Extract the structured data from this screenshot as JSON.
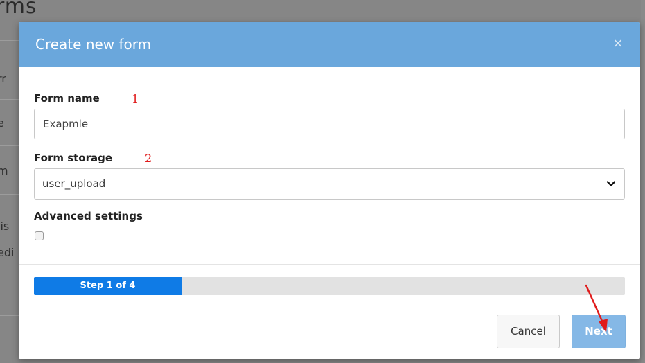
{
  "background": {
    "page_title_fragment": "rms",
    "row_fragments": [
      "rr",
      "e",
      "m",
      "lis",
      "edi"
    ]
  },
  "modal": {
    "title": "Create new form",
    "close_glyph": "×",
    "form_name": {
      "label": "Form name",
      "annotation": "1",
      "value": "Exapmle"
    },
    "form_storage": {
      "label": "Form storage",
      "annotation": "2",
      "selected": "user_upload"
    },
    "advanced_settings": {
      "label": "Advanced settings",
      "checked": false
    },
    "progress": {
      "text": "Step 1 of 4",
      "current_step": 1,
      "total_steps": 4
    },
    "buttons": {
      "cancel": "Cancel",
      "next": "Next"
    }
  },
  "colors": {
    "header": "#6aa7dc",
    "progress_fill": "#0f7be6",
    "next_button": "#85b8e6",
    "annotation": "#e01b1b"
  }
}
